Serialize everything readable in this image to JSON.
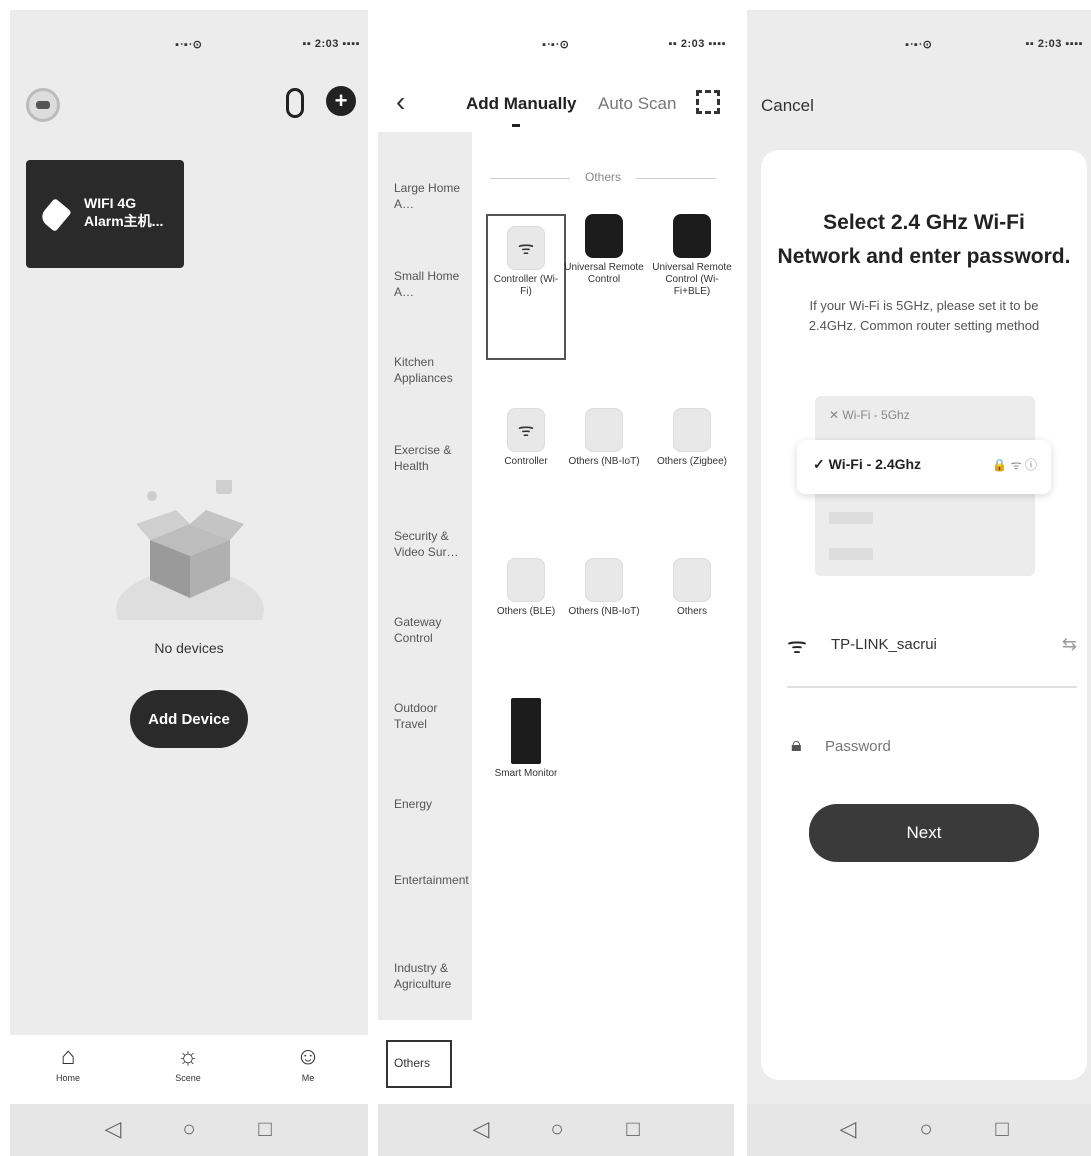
{
  "p1": {
    "status_center": "▪ᐧ▪ᐧ⊙",
    "status_right": "▪▪ 2:03 ▪▪▪▪",
    "banner": {
      "line1": "WIFI 4G",
      "line2": "Alarm主机..."
    },
    "empty_text": "No devices",
    "add_button": "Add Device",
    "tabs": [
      {
        "icon": "⌂",
        "label": "Home"
      },
      {
        "icon": "☼",
        "label": "Scene"
      },
      {
        "icon": "☺",
        "label": "Me"
      }
    ]
  },
  "p2": {
    "status_center": "▪ᐧ▪ᐧ⊙",
    "status_right": "▪▪ 2:03 ▪▪▪▪",
    "tab_manual": "Add Manually",
    "tab_auto": "Auto Scan",
    "categories": [
      "Large Home A…",
      "Small Home A…",
      "Kitchen Appliances",
      "Exercise & Health",
      "Security & Video Sur…",
      "Gateway Control",
      "Outdoor Travel",
      "Energy",
      "Entertainment",
      "Industry & Agriculture"
    ],
    "selected_category": "Others",
    "section_header": "Others",
    "devices": [
      {
        "label": "Controller (Wi-Fi)",
        "style": "light",
        "icon": "wifi-icon",
        "glyph": "ᯤ"
      },
      {
        "label": "Universal Remote Control",
        "style": "dark",
        "icon": "remote-icon",
        "glyph": ""
      },
      {
        "label": "Universal Remote Control (Wi-Fi+BLE)",
        "style": "dark",
        "icon": "remote-icon",
        "glyph": ""
      },
      {
        "label": "Controller",
        "style": "light",
        "icon": "wifi-icon",
        "glyph": "ᯤ"
      },
      {
        "label": "Others (NB-IoT)",
        "style": "light",
        "icon": "device-icon",
        "glyph": ""
      },
      {
        "label": "Others (Zigbee)",
        "style": "light",
        "icon": "device-icon",
        "glyph": ""
      },
      {
        "label": "Others (BLE)",
        "style": "light",
        "icon": "device-icon",
        "glyph": ""
      },
      {
        "label": "Others (NB-IoT)",
        "style": "light",
        "icon": "device-icon",
        "glyph": ""
      },
      {
        "label": "Others",
        "style": "light",
        "icon": "device-icon",
        "glyph": ""
      },
      {
        "label": "Smart Monitor",
        "style": "dark",
        "icon": "monitor-icon",
        "glyph": ""
      }
    ]
  },
  "p3": {
    "status_center": "▪ᐧ▪ᐧ⊙",
    "status_right": "▪▪ 2:03 ▪▪▪▪",
    "cancel": "Cancel",
    "title_line1": "Select 2.4 GHz Wi-Fi",
    "title_line2": "Network and enter password.",
    "subtitle": "If your Wi-Fi is 5GHz, please set it to be 2.4GHz. Common router setting method",
    "wifi_5g": "✕ Wi-Fi - 5Ghz",
    "wifi_24g": "✓ Wi-Fi - 2.4Ghz",
    "wifi_24g_icons": "🔒 ᯤ ⓘ",
    "ssid": "TP-LINK_sacrui",
    "password_placeholder": "Password",
    "next_button": "Next"
  },
  "navbar": {
    "back": "◁",
    "home": "○",
    "recent": "□"
  }
}
